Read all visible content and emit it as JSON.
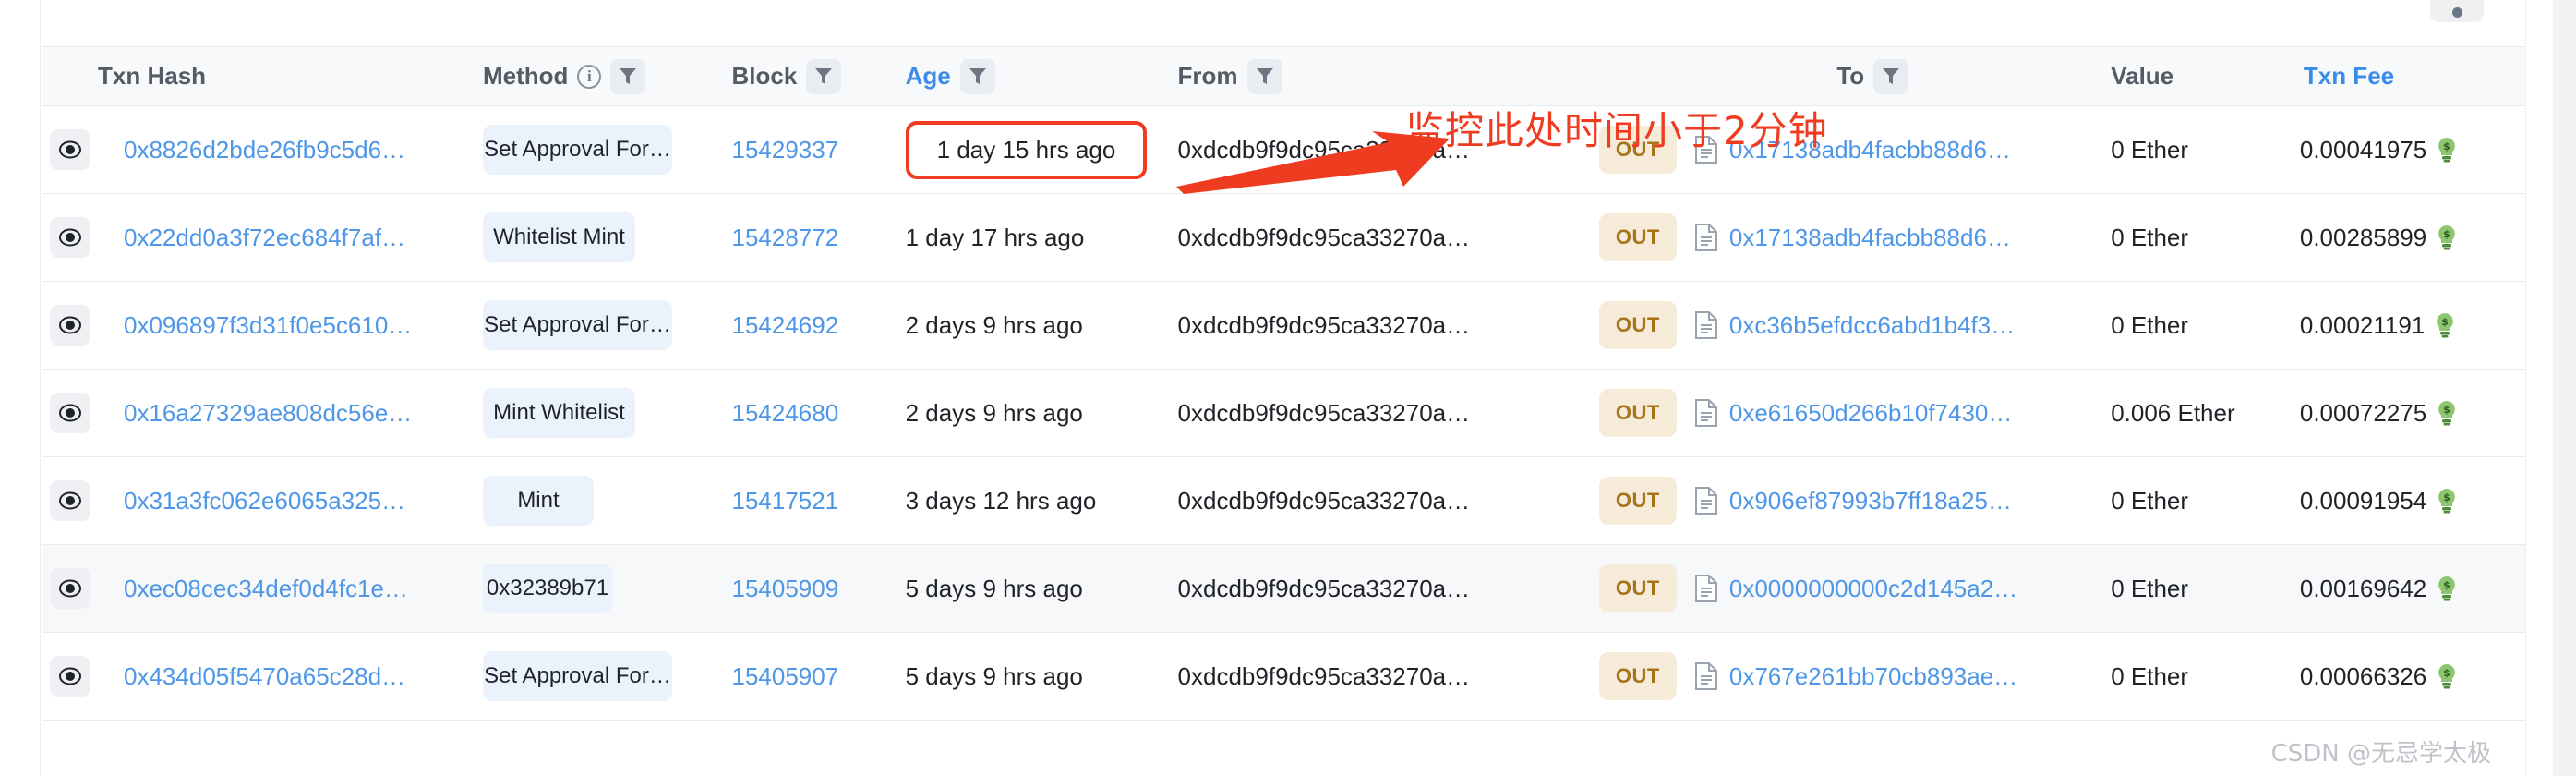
{
  "top_control": {
    "icon": "more-dot-icon"
  },
  "table": {
    "columns": [
      {
        "key": "eye",
        "label": ""
      },
      {
        "key": "hash",
        "label": "Txn Hash"
      },
      {
        "key": "method",
        "label": "Method",
        "info": "i",
        "filter": true
      },
      {
        "key": "block",
        "label": "Block",
        "filter": true
      },
      {
        "key": "age",
        "label": "Age",
        "filter": true,
        "link": true
      },
      {
        "key": "from",
        "label": "From",
        "filter": true
      },
      {
        "key": "dir",
        "label": ""
      },
      {
        "key": "to",
        "label": "To",
        "filter": true
      },
      {
        "key": "value",
        "label": "Value"
      },
      {
        "key": "fee",
        "label": "Txn Fee",
        "link": true
      }
    ],
    "rows": [
      {
        "hash": "0x8826d2bde26fb9c5d6…",
        "method": "Set Approval For…",
        "method_width": "wide",
        "block": "15429337",
        "age": "1 day 15 hrs ago",
        "age_highlighted": true,
        "from": "0xdcdb9f9dc95ca33270a…",
        "direction": "OUT",
        "to": "0x17138adb4facbb88d6…",
        "value": "0 Ether",
        "fee": "0.00041975",
        "alt": false
      },
      {
        "hash": "0x22dd0a3f72ec684f7af…",
        "method": "Whitelist Mint",
        "method_width": "mid",
        "block": "15428772",
        "age": "1 day 17 hrs ago",
        "age_highlighted": false,
        "from": "0xdcdb9f9dc95ca33270a…",
        "direction": "OUT",
        "to": "0x17138adb4facbb88d6…",
        "value": "0 Ether",
        "fee": "0.00285899",
        "alt": false
      },
      {
        "hash": "0x096897f3d31f0e5c610…",
        "method": "Set Approval For…",
        "method_width": "wide",
        "block": "15424692",
        "age": "2 days 9 hrs ago",
        "age_highlighted": false,
        "from": "0xdcdb9f9dc95ca33270a…",
        "direction": "OUT",
        "to": "0xc36b5efdcc6abd1b4f3…",
        "value": "0 Ether",
        "fee": "0.00021191",
        "alt": false
      },
      {
        "hash": "0x16a27329ae808dc56e…",
        "method": "Mint Whitelist",
        "method_width": "mid",
        "block": "15424680",
        "age": "2 days 9 hrs ago",
        "age_highlighted": false,
        "from": "0xdcdb9f9dc95ca33270a…",
        "direction": "OUT",
        "to": "0xe61650d266b10f7430…",
        "value": "0.006 Ether",
        "fee": "0.00072275",
        "alt": false
      },
      {
        "hash": "0x31a3fc062e6065a325…",
        "method": "Mint",
        "method_width": "small",
        "block": "15417521",
        "age": "3 days 12 hrs ago",
        "age_highlighted": false,
        "from": "0xdcdb9f9dc95ca33270a…",
        "direction": "OUT",
        "to": "0x906ef87993b7ff18a25…",
        "value": "0 Ether",
        "fee": "0.00091954",
        "alt": false
      },
      {
        "hash": "0xec08cec34def0d4fc1e…",
        "method": "0x32389b71",
        "method_width": "hex",
        "block": "15405909",
        "age": "5 days 9 hrs ago",
        "age_highlighted": false,
        "from": "0xdcdb9f9dc95ca33270a…",
        "direction": "OUT",
        "to": "0x0000000000c2d145a2…",
        "value": "0 Ether",
        "fee": "0.00169642",
        "alt": true
      },
      {
        "hash": "0x434d05f5470a65c28d…",
        "method": "Set Approval For…",
        "method_width": "wide",
        "block": "15405907",
        "age": "5 days 9 hrs ago",
        "age_highlighted": false,
        "from": "0xdcdb9f9dc95ca33270a…",
        "direction": "OUT",
        "to": "0x767e261bb70cb893ae…",
        "value": "0 Ether",
        "fee": "0.00066326",
        "alt": false
      }
    ]
  },
  "annotation": {
    "text": "监控此处时间小于2分钟",
    "color": "#ef3b20",
    "arrow": "arrow-right-icon"
  },
  "watermark": {
    "text": "CSDN @无忌学太极"
  },
  "colors": {
    "link": "#4d96e8",
    "header_bg": "#f8f9fb",
    "method_pill_bg": "#eaf2fc",
    "out_badge_bg": "#f6ebd8",
    "out_badge_text": "#a6741b",
    "annotation": "#ef3b20"
  }
}
